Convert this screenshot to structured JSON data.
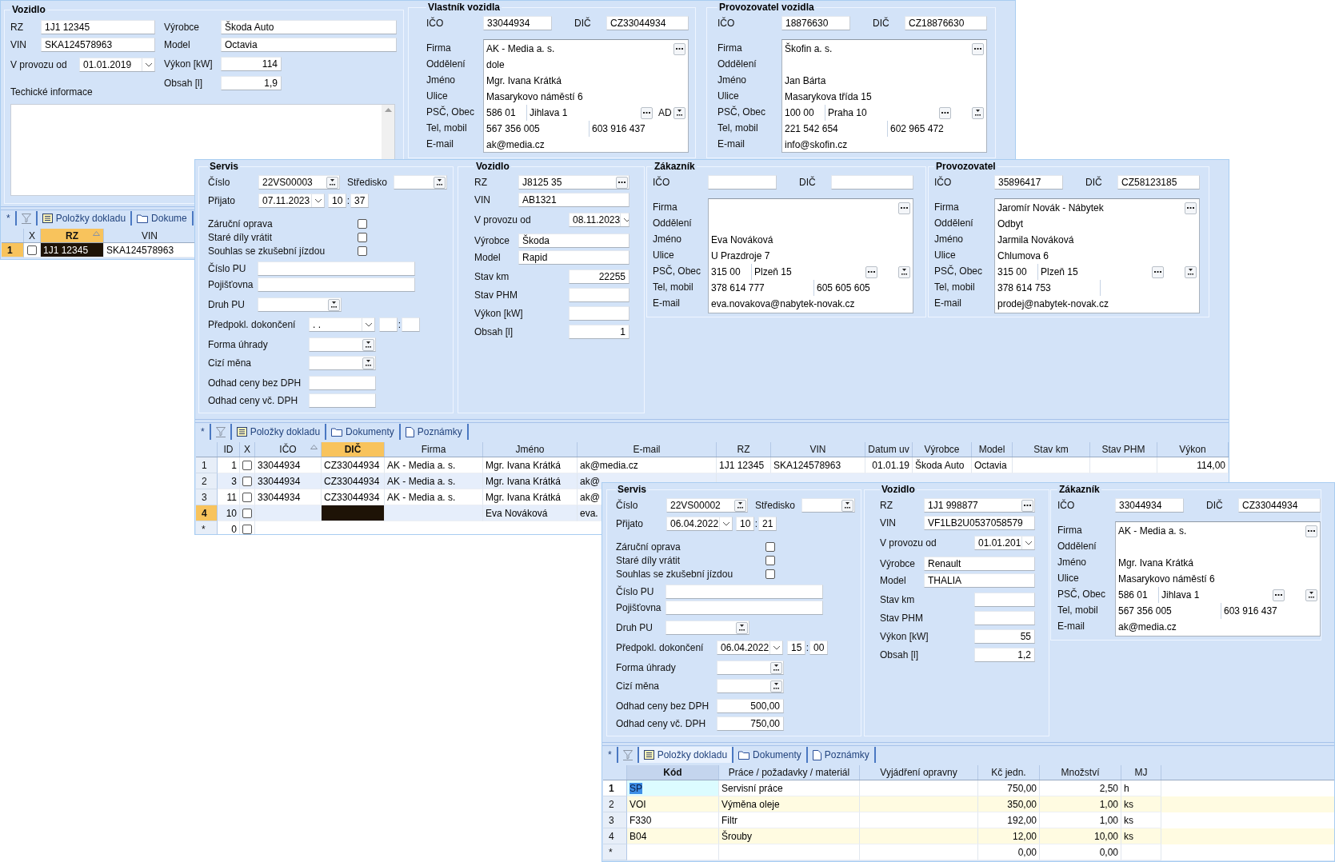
{
  "vehicle_window": {
    "vehicle": {
      "title": "Vozidlo",
      "rz": {
        "label": "RZ",
        "value": "1J1 12345"
      },
      "vin": {
        "label": "VIN",
        "value": "SKA124578963"
      },
      "in_service": {
        "label": "V provozu od",
        "value": "01.01.2019"
      },
      "maker": {
        "label": "Výrobce",
        "value": "Škoda Auto"
      },
      "model": {
        "label": "Model",
        "value": "Octavia"
      },
      "power": {
        "label": "Výkon [kW]",
        "value": "114"
      },
      "volume": {
        "label": "Obsah [l]",
        "value": "1,9"
      },
      "notes_label": "Techické informace"
    },
    "owner": {
      "title": "Vlastník vozidla",
      "ico": {
        "label": "IČO",
        "value": "33044934"
      },
      "dic": {
        "label": "DIČ",
        "value": "CZ33044934"
      },
      "labels": [
        "Firma",
        "Oddělení",
        "Jméno",
        "Ulice",
        "PSČ, Obec",
        "Tel, mobil",
        "E-mail"
      ],
      "company": "AK - Media a. s.",
      "department": "dole",
      "name": "Mgr. Ivana Krátká",
      "street": "Masarykovo náměstí 6",
      "zip": "586 01",
      "city": "Jihlava 1",
      "extra": "AD",
      "phone": "567 356 005",
      "mobile": "603 916 437",
      "email": "ak@media.cz"
    },
    "operator": {
      "title": "Provozovatel vozidla",
      "ico": {
        "label": "IČO",
        "value": "18876630"
      },
      "dic": {
        "label": "DIČ",
        "value": "CZ18876630"
      },
      "labels": [
        "Firma",
        "Oddělení",
        "Jméno",
        "Ulice",
        "PSČ, Obec",
        "Tel, mobil",
        "E-mail"
      ],
      "company": "Škofin a. s.",
      "name": "Jan Bárta",
      "street": "Masarykova třída 15",
      "zip": "100 00",
      "city": "Praha 10",
      "phone": "221 542 654",
      "mobile": "602 965 472",
      "email": "info@skofin.cz"
    },
    "grid": {
      "active": false,
      "new_label": "*",
      "tabs": [
        {
          "label": "Položky dokladu",
          "kind": "list",
          "selected": false
        },
        {
          "label": "Dokume",
          "kind": "folder",
          "selected": false
        }
      ],
      "columns": [
        {
          "label": "X",
          "kind": "check",
          "sorted": false,
          "current": false
        },
        {
          "label": "RZ",
          "kind": "text",
          "sorted": true,
          "current": true
        },
        {
          "label": "VIN",
          "kind": "text",
          "sorted": false,
          "current": false
        }
      ],
      "rows": [
        {
          "marker": "1",
          "selected": true,
          "cells": [
            {
              "checked": false
            },
            {
              "text": "1J1 12345",
              "current": true
            },
            "SKA124578963"
          ]
        }
      ]
    }
  },
  "service_window": {
    "service": {
      "title": "Servis",
      "number": {
        "label": "Číslo",
        "value": "22VS00003"
      },
      "center": {
        "label": "Středisko"
      },
      "received": {
        "label": "Přijato",
        "date": "07.11.2023",
        "hour": "10",
        "minute": "37",
        "separator": ":"
      },
      "checks": [
        {
          "label": "Záruční oprava",
          "checked": false
        },
        {
          "label": "Staré díly vrátit",
          "checked": false
        },
        {
          "label": "Souhlas se zkušební jízdou",
          "checked": false
        }
      ],
      "claim_number": {
        "label": "Číslo PU"
      },
      "insurer": {
        "label": "Pojišťovna"
      },
      "claim_type": {
        "label": "Druh PU"
      },
      "completion": {
        "label": "Předpokl. dokončení",
        "date": ". .",
        "separator": ":"
      },
      "payment": {
        "label": "Forma úhrady"
      },
      "currency": {
        "label": "Cizí měna"
      },
      "estimate_net": {
        "label": "Odhad ceny bez DPH"
      },
      "estimate_gross": {
        "label": "Odhad ceny vč. DPH"
      }
    },
    "vehicle": {
      "title": "Vozidlo",
      "rz": {
        "label": "RZ",
        "value": "J8125 35"
      },
      "vin": {
        "label": "VIN",
        "value": "AB1321"
      },
      "in_service": {
        "label": "V provozu od",
        "value": "08.11.2023"
      },
      "maker": {
        "label": "Výrobce",
        "value": "Škoda"
      },
      "model": {
        "label": "Model",
        "value": "Rapid"
      },
      "odometer": {
        "label": "Stav km",
        "value": "22255"
      },
      "fuel": {
        "label": "Stav PHM"
      },
      "power": {
        "label": "Výkon [kW]"
      },
      "volume": {
        "label": "Obsah [l]",
        "value": "1"
      }
    },
    "customer": {
      "title": "Zákazník",
      "ico": {
        "label": "IČO"
      },
      "dic": {
        "label": "DIČ"
      },
      "labels": [
        "Firma",
        "Oddělení",
        "Jméno",
        "Ulice",
        "PSČ, Obec",
        "Tel, mobil",
        "E-mail"
      ],
      "name": "Eva Nováková",
      "street": "U Prazdroje 7",
      "zip": "315 00",
      "city": "Plzeň 15",
      "phone": "378 614 777",
      "mobile": "605 605 605",
      "email": "eva.novakova@nabytek-novak.cz"
    },
    "operator": {
      "title": "Provozovatel",
      "ico": {
        "label": "IČO",
        "value": "35896417"
      },
      "dic": {
        "label": "DIČ",
        "value": "CZ58123185"
      },
      "labels": [
        "Firma",
        "Oddělení",
        "Jméno",
        "Ulice",
        "PSČ, Obec",
        "Tel, mobil",
        "E-mail"
      ],
      "company": "Jaromír Novák - Nábytek",
      "department": "Odbyt",
      "name": "Jarmila Nováková",
      "street": "Chlumova 6",
      "zip": "315 00",
      "city": "Plzeň 15",
      "phone": "378 614 753",
      "email": "prodej@nabytek-novak.cz"
    },
    "grid": {
      "active": false,
      "new_label": "*",
      "tabs": [
        {
          "label": "Položky dokladu",
          "kind": "list",
          "selected": false
        },
        {
          "label": "Dokumenty",
          "kind": "folder",
          "selected": false
        },
        {
          "label": "Poznámky",
          "kind": "note",
          "selected": false
        }
      ],
      "columns": [
        {
          "label": "ID",
          "kind": "number",
          "sorted": false,
          "current": false
        },
        {
          "label": "X",
          "kind": "check",
          "sorted": false,
          "current": false
        },
        {
          "label": "IČO",
          "kind": "text",
          "sorted": true,
          "current": false
        },
        {
          "label": "DIČ",
          "kind": "text",
          "sorted": false,
          "current": true
        },
        {
          "label": "Firma",
          "kind": "text",
          "sorted": false,
          "current": false
        },
        {
          "label": "Jméno",
          "kind": "text",
          "sorted": false,
          "current": false
        },
        {
          "label": "E-mail",
          "kind": "text",
          "sorted": false,
          "current": false
        },
        {
          "label": "RZ",
          "kind": "text",
          "sorted": false,
          "current": false
        },
        {
          "label": "VIN",
          "kind": "text",
          "sorted": false,
          "current": false
        },
        {
          "label": "Datum uv",
          "kind": "number",
          "sorted": false,
          "current": false
        },
        {
          "label": "Výrobce",
          "kind": "text",
          "sorted": false,
          "current": false
        },
        {
          "label": "Model",
          "kind": "text",
          "sorted": false,
          "current": false
        },
        {
          "label": "Stav km",
          "kind": "number",
          "sorted": false,
          "current": false
        },
        {
          "label": "Stav PHM",
          "kind": "number",
          "sorted": false,
          "current": false
        },
        {
          "label": "Výkon",
          "kind": "number",
          "sorted": false,
          "current": false
        }
      ],
      "rows": [
        {
          "marker": "1",
          "selected": false,
          "cells": [
            "1",
            {
              "checked": false
            },
            "33044934",
            "CZ33044934",
            "AK - Media a. s.",
            "Mgr. Ivana Krátká",
            "ak@media.cz",
            "1J1 12345",
            "SKA124578963",
            "01.01.19",
            "Škoda Auto",
            "Octavia",
            null,
            null,
            "114,00"
          ]
        },
        {
          "marker": "2",
          "selected": false,
          "cells": [
            "3",
            {
              "checked": false
            },
            "33044934",
            "CZ33044934",
            "AK - Media a. s.",
            "Mgr. Ivana Krátká",
            "ak@"
          ]
        },
        {
          "marker": "3",
          "selected": false,
          "cells": [
            "11",
            {
              "checked": false
            },
            "33044934",
            "CZ33044934",
            "AK - Media a. s.",
            "Mgr. Ivana Krátká",
            "ak@"
          ]
        },
        {
          "marker": "4",
          "selected": true,
          "cells": [
            "10",
            {
              "checked": false
            },
            null,
            {
              "current": true
            },
            null,
            "Eva Nováková",
            "eva."
          ]
        },
        {
          "marker": "*",
          "selected": false,
          "cells": [
            "0",
            {
              "checked": false
            }
          ]
        }
      ]
    }
  },
  "service_window_2": {
    "service": {
      "title": "Servis",
      "number": {
        "label": "Číslo",
        "value": "22VS00002"
      },
      "center": {
        "label": "Středisko"
      },
      "received": {
        "label": "Přijato",
        "date": "06.04.2022",
        "hour": "10",
        "minute": "21",
        "separator": ":"
      },
      "checks": [
        {
          "label": "Záruční oprava",
          "checked": false
        },
        {
          "label": "Staré díly vrátit",
          "checked": false
        },
        {
          "label": "Souhlas se zkušební jízdou",
          "checked": false
        }
      ],
      "claim_number": {
        "label": "Číslo PU"
      },
      "insurer": {
        "label": "Pojišťovna"
      },
      "claim_type": {
        "label": "Druh PU"
      },
      "completion": {
        "label": "Předpokl. dokončení",
        "date": "06.04.2022",
        "hour": "15",
        "minute": "00",
        "separator": ":"
      },
      "payment": {
        "label": "Forma úhrady"
      },
      "currency": {
        "label": "Cizí měna"
      },
      "estimate_net": {
        "label": "Odhad ceny bez DPH",
        "value": "500,00"
      },
      "estimate_gross": {
        "label": "Odhad ceny vč. DPH",
        "value": "750,00"
      }
    },
    "vehicle": {
      "title": "Vozidlo",
      "rz": {
        "label": "RZ",
        "value": "1J1 998877"
      },
      "vin": {
        "label": "VIN",
        "value": "VF1LB2U0537058579"
      },
      "in_service": {
        "label": "V provozu od",
        "value": "01.01.201"
      },
      "maker": {
        "label": "Výrobce",
        "value": "Renault"
      },
      "model": {
        "label": "Model",
        "value": "THALIA"
      },
      "odometer": {
        "label": "Stav km"
      },
      "fuel": {
        "label": "Stav PHM"
      },
      "power": {
        "label": "Výkon [kW]",
        "value": "55"
      },
      "volume": {
        "label": "Obsah [l]",
        "value": "1,2"
      }
    },
    "customer": {
      "title": "Zákazník",
      "ico": {
        "label": "IČO",
        "value": "33044934"
      },
      "dic": {
        "label": "DIČ",
        "value": "CZ33044934"
      },
      "labels": [
        "Firma",
        "Oddělení",
        "Jméno",
        "Ulice",
        "PSČ, Obec",
        "Tel, mobil",
        "E-mail"
      ],
      "company": "AK - Media a. s.",
      "name": "Mgr. Ivana Krátká",
      "street": "Masarykovo náměstí 6",
      "zip": "586 01",
      "city": "Jihlava 1",
      "phone": "567 356 005",
      "mobile": "603 916 437",
      "email": "ak@media.cz"
    },
    "grid": {
      "active": true,
      "new_label": "*",
      "tabs": [
        {
          "label": "Položky dokladu",
          "kind": "list",
          "selected": true
        },
        {
          "label": "Dokumenty",
          "kind": "folder",
          "selected": false
        },
        {
          "label": "Poznámky",
          "kind": "note",
          "selected": false
        }
      ],
      "columns": [
        {
          "label": "Kód",
          "kind": "text",
          "sorted": false,
          "current": true
        },
        {
          "label": "Práce / požadavky / materiál",
          "kind": "text",
          "sorted": false,
          "current": false
        },
        {
          "label": "Vyjádření opravny",
          "kind": "text",
          "sorted": false,
          "current": false
        },
        {
          "label": "Kč jedn.",
          "kind": "number",
          "sorted": false,
          "current": false
        },
        {
          "label": "Množství",
          "kind": "number",
          "sorted": false,
          "current": false
        },
        {
          "label": "MJ",
          "kind": "text",
          "sorted": false,
          "current": false
        }
      ],
      "rows": [
        {
          "marker": "1",
          "selected": true,
          "cells": [
            {
              "text": "SP",
              "current": true
            },
            "Servisní práce",
            null,
            "750,00",
            "2,50",
            "h"
          ]
        },
        {
          "marker": "2",
          "selected": false,
          "cells": [
            "VOI",
            "Výměna oleje",
            null,
            "350,00",
            "1,00",
            "ks"
          ]
        },
        {
          "marker": "3",
          "selected": false,
          "cells": [
            "F330",
            "Filtr",
            null,
            "192,00",
            "1,00",
            "ks"
          ]
        },
        {
          "marker": "4",
          "selected": false,
          "cells": [
            "B04",
            "Šrouby",
            null,
            "12,00",
            "10,00",
            "ks"
          ]
        },
        {
          "marker": "*",
          "selected": false,
          "cells": [
            null,
            null,
            null,
            "0,00",
            "0,00",
            null
          ]
        }
      ]
    }
  }
}
